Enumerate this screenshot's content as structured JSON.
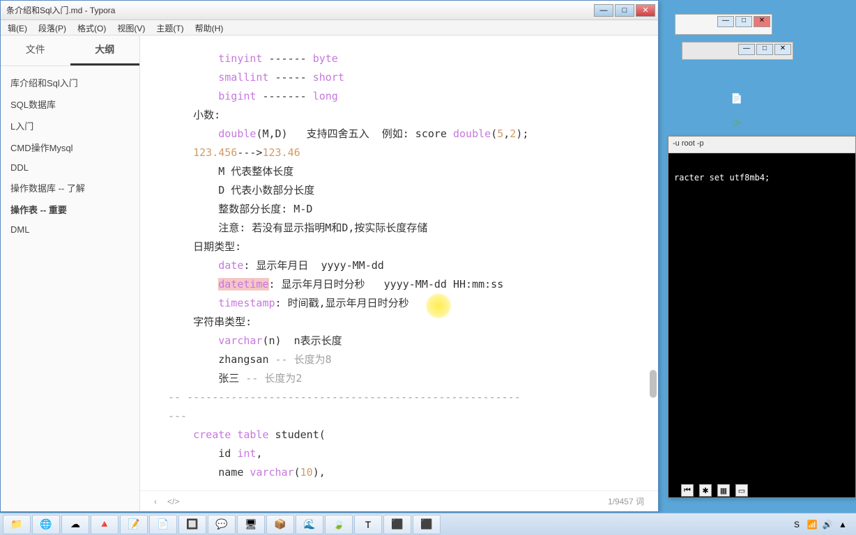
{
  "window": {
    "title": "条介绍和Sql入门.md - Typora"
  },
  "menubar": {
    "items": [
      "辑(E)",
      "段落(P)",
      "格式(O)",
      "视图(V)",
      "主题(T)",
      "帮助(H)"
    ]
  },
  "sidebar": {
    "tabs": {
      "files": "文件",
      "outline": "大纲"
    },
    "outline": [
      "库介绍和Sql入门",
      "SQL数据库",
      "L入门",
      "CMD操作Mysql",
      "DDL",
      "操作数据库 -- 了解",
      "操作表 -- 重要",
      "DML"
    ]
  },
  "content": {
    "line1a": "tinyint",
    "line1b": " ------ ",
    "line1c": "byte",
    "line2a": "smallint",
    "line2b": " ----- ",
    "line2c": "short",
    "line3a": "bigint",
    "line3b": " ------- ",
    "line3c": "long",
    "line4": "小数:",
    "line5a": "double",
    "line5b": "(M,D)   支持四舍五入  例如: score ",
    "line5c": "double",
    "line5d": "(",
    "line5e": "5",
    "line5f": ",",
    "line5g": "2",
    "line5h": ");",
    "line6a": "123.456",
    "line6b": "--->",
    "line6c": "123.46",
    "line7": "M 代表整体长度",
    "line8": "D 代表小数部分长度",
    "line9": "整数部分长度: M-D",
    "line10": "注意: 若没有显示指明M和D,按实际长度存储",
    "line11": "日期类型:",
    "line12a": "date",
    "line12b": ": 显示年月日  yyyy-MM-dd",
    "line13a": "datetime",
    "line13b": ": 显示年月日时分秒   yyyy-MM-dd HH:mm:ss",
    "line14a": "timestamp",
    "line14b": ": 时间戳,显示年月日时分秒",
    "line15": "字符串类型:",
    "line16a": "varchar",
    "line16b": "(n)  n表示长度",
    "line17a": "zhangsan ",
    "line17b": "-- 长度为8",
    "line18a": "张三 ",
    "line18b": "-- 长度为2",
    "line19": "-- -----------------------------------------------------",
    "line20": "---",
    "line21a": "create",
    "line21b": " table",
    "line21c": " student(",
    "line22a": "    id ",
    "line22b": "int",
    "line22c": ",",
    "line23a": "    name ",
    "line23b": "varchar",
    "line23c": "(",
    "line23d": "10",
    "line23e": "),"
  },
  "footer": {
    "back": "‹",
    "code": "</>",
    "wordcount": "1/9457 词"
  },
  "cmd": {
    "title": "-u root -p",
    "line1": "racter set utf8mb4;"
  },
  "taskbar": {
    "icons": [
      "📁",
      "🌐",
      "☁",
      "🔺",
      "📝",
      "📄",
      "🔲",
      "💬",
      "🖥",
      "📦",
      "🌊",
      "🍃",
      "T",
      "⬛",
      "⬛"
    ]
  }
}
